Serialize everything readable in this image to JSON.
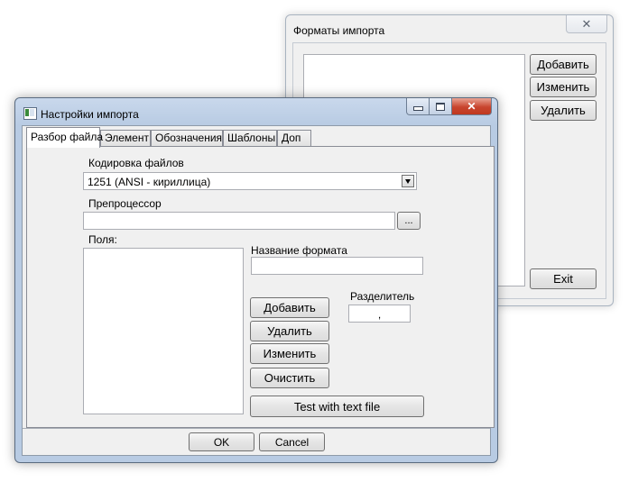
{
  "formats_window": {
    "title": "Форматы импорта",
    "close_glyph": "✕",
    "buttons": {
      "add": "Добавить",
      "edit": "Изменить",
      "delete": "Удалить",
      "exit": "Exit"
    }
  },
  "settings_window": {
    "title": "Настройки импорта",
    "caption_buttons": {
      "close": "✕"
    },
    "tabs": [
      {
        "label": "Разбор файла",
        "active": true
      },
      {
        "label": "Элемент",
        "active": false
      },
      {
        "label": "Обозначения",
        "active": false
      },
      {
        "label": "Шаблоны",
        "active": false
      },
      {
        "label": "Доп",
        "active": false
      }
    ],
    "encoding": {
      "label": "Кодировка файлов",
      "value": "1251  (ANSI - кириллица)"
    },
    "preprocessor": {
      "label": "Препроцессор",
      "value": "",
      "browse_label": "..."
    },
    "fields": {
      "label": "Поля:"
    },
    "format_name": {
      "label": "Название формата",
      "value": ""
    },
    "separator": {
      "label": "Разделитель",
      "value": ","
    },
    "buttons": {
      "add": "Добавить",
      "delete": "Удалить",
      "edit": "Изменить",
      "clear": "Очистить",
      "test": "Test with text file",
      "ok": "OK",
      "cancel": "Cancel"
    }
  }
}
